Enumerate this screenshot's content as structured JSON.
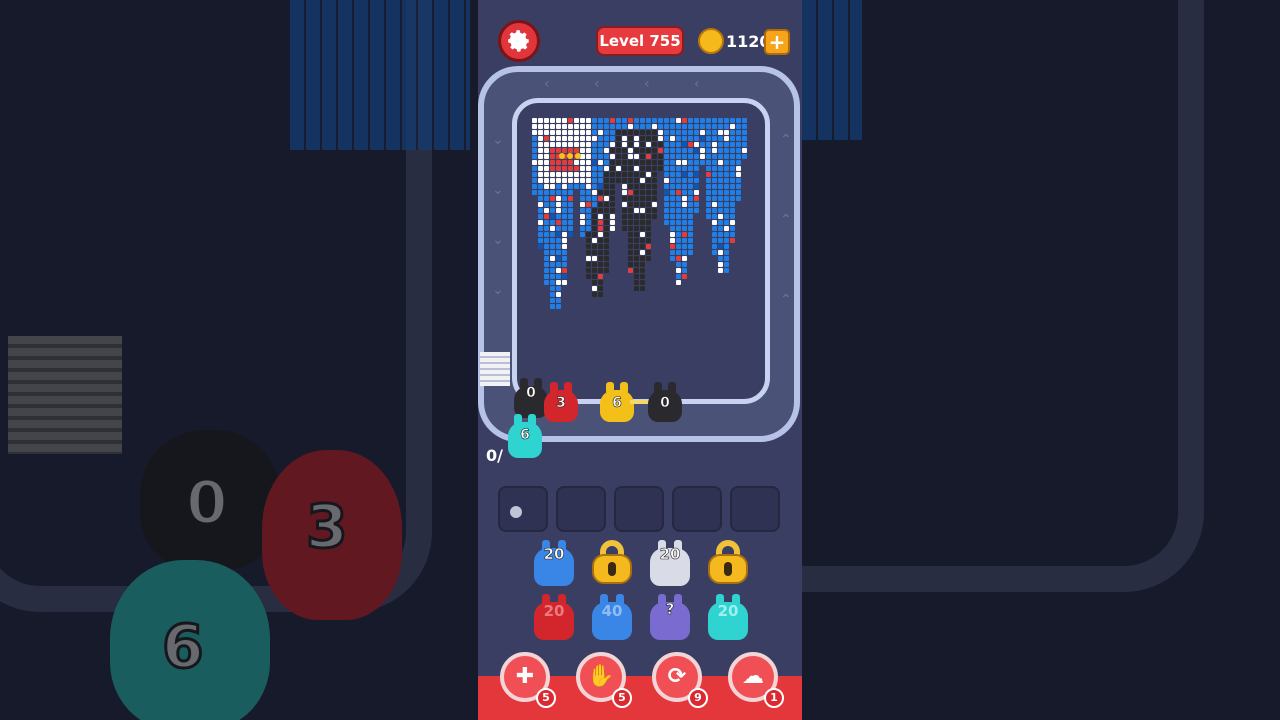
{
  "hud": {
    "level_label": "Level 755",
    "coins": "1120",
    "add_coins_symbol": "+"
  },
  "conveyor_shooters": [
    {
      "color": "black",
      "count": "0"
    },
    {
      "color": "red",
      "count": "3"
    },
    {
      "color": "yellow",
      "count": "6"
    },
    {
      "color": "black",
      "count": "0"
    },
    {
      "color": "cyan",
      "count": "6"
    }
  ],
  "queue_counter": "0/",
  "slots": [
    {
      "state": "occupied-dot"
    },
    {
      "state": "empty"
    },
    {
      "state": "empty"
    },
    {
      "state": "empty"
    },
    {
      "state": "empty"
    }
  ],
  "shooter_grid": [
    [
      {
        "color": "blue",
        "count": "20"
      },
      {
        "color": "locked",
        "count": ""
      },
      {
        "color": "white",
        "count": "20"
      },
      {
        "color": "locked",
        "count": ""
      }
    ],
    [
      {
        "color": "red",
        "count": "20"
      },
      {
        "color": "blue",
        "count": "40"
      },
      {
        "color": "purple",
        "count": "?"
      },
      {
        "color": "cyan",
        "count": "20"
      }
    ]
  ],
  "boosters": [
    {
      "icon": "add-slot-icon",
      "count": "5"
    },
    {
      "icon": "hand-icon",
      "count": "5"
    },
    {
      "icon": "shuffle-icon",
      "count": "9"
    },
    {
      "icon": "magnet-icon",
      "count": "1"
    }
  ],
  "background": {
    "left_numbers": [
      "0",
      "3",
      "6"
    ]
  },
  "colors": {
    "accent_red": "#e4373c",
    "track": "#b6c2e7",
    "panel": "#3b3e63",
    "coin": "#f5b91b"
  }
}
